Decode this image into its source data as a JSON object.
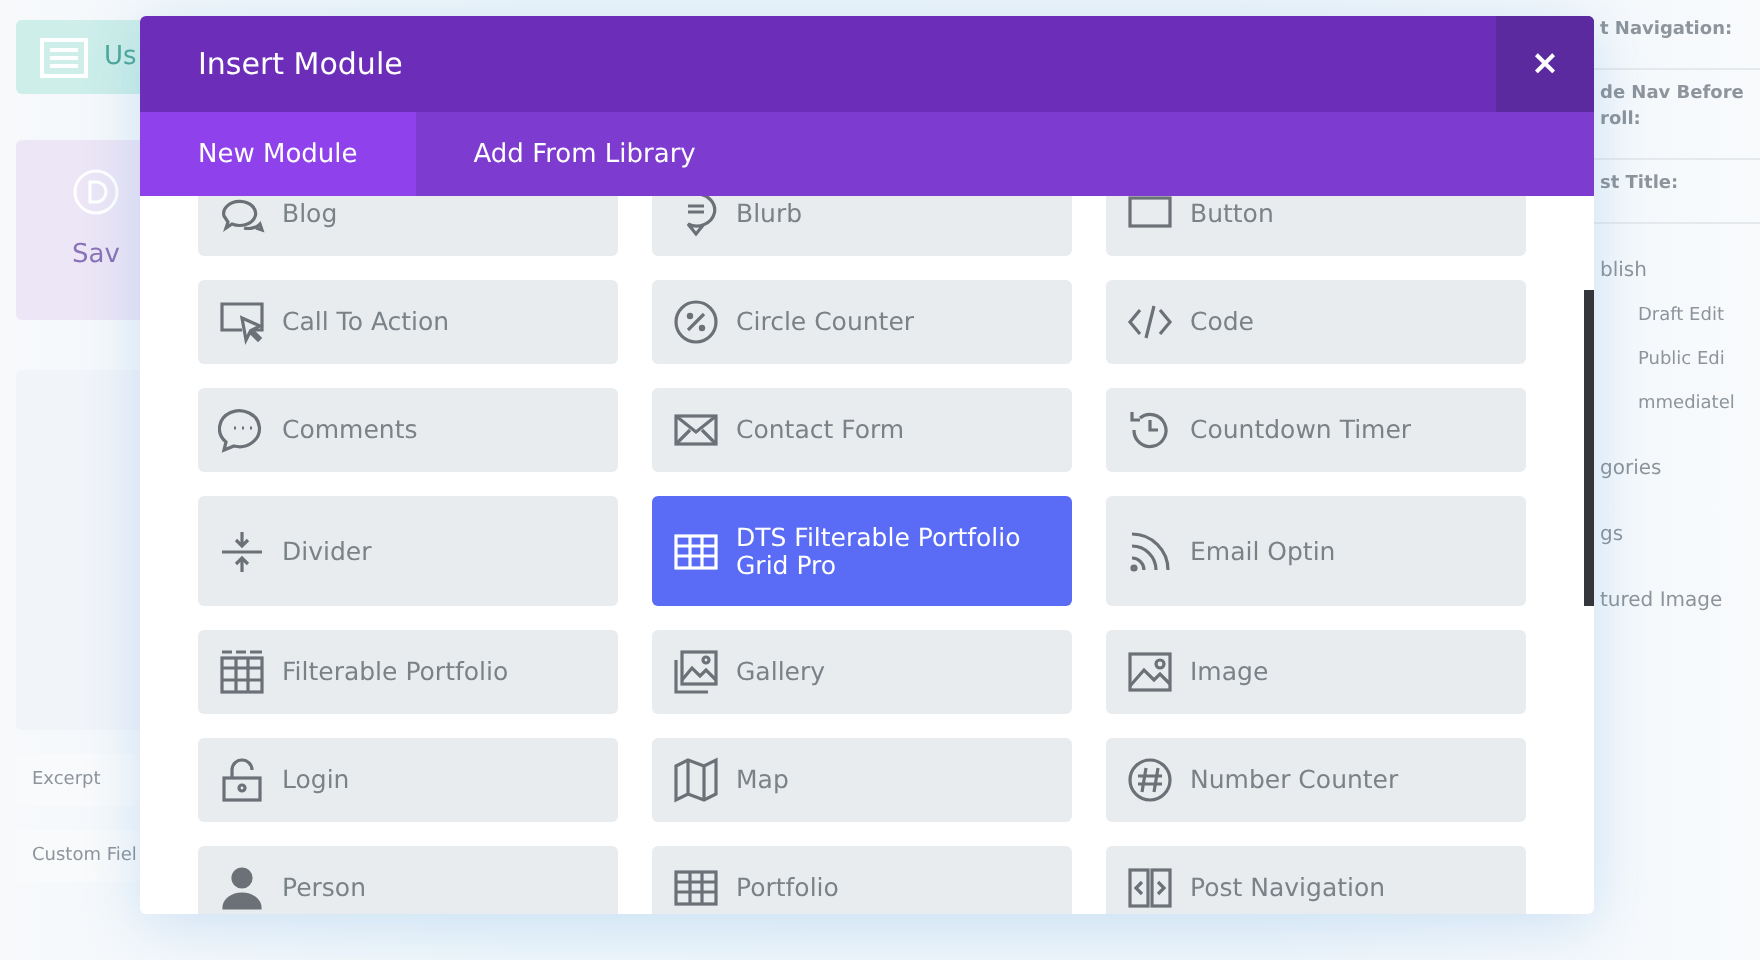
{
  "background": {
    "left": {
      "banner": "Us",
      "card_button": "Sav",
      "fields": [
        "Excerpt",
        "Custom Fiel"
      ]
    },
    "right": [
      {
        "kind": "label",
        "text": "t Navigation:"
      },
      {
        "kind": "label",
        "text": "de Nav Before roll:"
      },
      {
        "kind": "label",
        "text": "st Title:"
      },
      {
        "kind": "section",
        "text": "blish"
      },
      {
        "kind": "status",
        "text": "Draft Edit"
      },
      {
        "kind": "status",
        "text": "Public Edi"
      },
      {
        "kind": "status",
        "text": "mmediatel"
      },
      {
        "kind": "section",
        "text": "gories"
      },
      {
        "kind": "section",
        "text": "gs"
      },
      {
        "kind": "section",
        "text": "tured Image"
      }
    ]
  },
  "modal": {
    "title": "Insert Module",
    "close": "×",
    "tabs": [
      {
        "label": "New Module",
        "selected": true
      },
      {
        "label": "Add From Library",
        "selected": false
      }
    ],
    "modules": [
      {
        "label": "Blog",
        "selected": false
      },
      {
        "label": "Blurb",
        "selected": false
      },
      {
        "label": "Button",
        "selected": false
      },
      {
        "label": "Call To Action",
        "selected": false
      },
      {
        "label": "Circle Counter",
        "selected": false
      },
      {
        "label": "Code",
        "selected": false
      },
      {
        "label": "Comments",
        "selected": false
      },
      {
        "label": "Contact Form",
        "selected": false
      },
      {
        "label": "Countdown Timer",
        "selected": false
      },
      {
        "label": "Divider",
        "selected": false
      },
      {
        "label": "DTS Filterable Portfolio Grid Pro",
        "selected": true
      },
      {
        "label": "Email Optin",
        "selected": false
      },
      {
        "label": "Filterable Portfolio",
        "selected": false
      },
      {
        "label": "Gallery",
        "selected": false
      },
      {
        "label": "Image",
        "selected": false
      },
      {
        "label": "Login",
        "selected": false
      },
      {
        "label": "Map",
        "selected": false
      },
      {
        "label": "Number Counter",
        "selected": false
      },
      {
        "label": "Person",
        "selected": false
      },
      {
        "label": "Portfolio",
        "selected": false
      },
      {
        "label": "Post Navigation",
        "selected": false
      }
    ]
  }
}
